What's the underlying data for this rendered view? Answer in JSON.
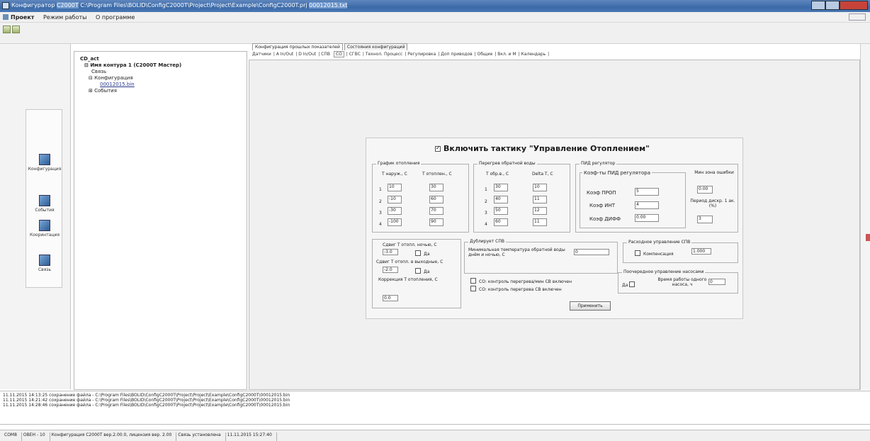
{
  "window": {
    "title_parts": [
      "Конфигуратор",
      "С2000Т",
      "C:\\Program Files\\BOLID\\ConfigC2000T\\Project\\Project\\Example\\ConfigC2000T.prj",
      "00012015.txt"
    ]
  },
  "menu": {
    "items": [
      "Проект",
      "Режим работы",
      "О программе"
    ]
  },
  "nav": {
    "items": [
      {
        "label": "Конфигурация",
        "icon": "config-icon"
      },
      {
        "label": "События",
        "icon": "events-icon"
      },
      {
        "label": "Кооринтация",
        "icon": "coordination-icon"
      },
      {
        "label": "Связь",
        "icon": "connection-icon"
      }
    ]
  },
  "tree": {
    "root": "CD_act",
    "device": "Имя контура 1 (С2000Т Мастер)",
    "nodes": [
      "Связь",
      "Конфигурация",
      "00012015.bin",
      "События"
    ]
  },
  "tabs_top": [
    "Конфигурация прошлых показателей",
    "Состояния конфигураций"
  ],
  "tabs_sub": [
    "Датчики",
    "A In/Out",
    "D In/Out",
    "СПВ",
    "CO",
    "СГВС",
    "Технол. Процесс",
    "Регулировка",
    "Доп приводов",
    "Общие",
    "Вкл. и М",
    "Календарь"
  ],
  "active_sub_tab": "CO",
  "heating": {
    "enable_label": "Включить тактику \"Управление Отоплением\"",
    "enabled": true,
    "graph": {
      "title": "График отопления",
      "col1": "Т наруж., С",
      "col2": "Т отоплен., С",
      "rows": [
        {
          "n": "1",
          "a": "10",
          "b": "30"
        },
        {
          "n": "2",
          "a": "-10",
          "b": "60"
        },
        {
          "n": "3",
          "a": "-30",
          "b": "70"
        },
        {
          "n": "4",
          "a": "-100",
          "b": "90"
        }
      ]
    },
    "return": {
      "title": "Перегрев обратной воды",
      "col1": "Т обр.в., С",
      "col2": "Delta T, С",
      "rows": [
        {
          "n": "1",
          "a": "30",
          "b": "10"
        },
        {
          "n": "2",
          "a": "40",
          "b": "11"
        },
        {
          "n": "3",
          "a": "50",
          "b": "12"
        },
        {
          "n": "4",
          "a": "60",
          "b": "11"
        }
      ]
    },
    "pid": {
      "title": "ПИД регулятор",
      "coef_title": "Коэф-ты ПИД регулятора",
      "prop_label": "Коэф ПРОП",
      "prop": "5",
      "int_label": "Коэф ИНТ",
      "int": "4",
      "diff_label": "Коэф ДИФФ",
      "diff": "0.00",
      "zone_label": "Мин зона ошибки",
      "zone": "0.00",
      "period_label": "Период дискр. 1 ак.(%)",
      "period": "3"
    },
    "shift": {
      "title": "Сдвиг Т отопл. ночью, С",
      "night": "-3.0",
      "night_chk": "Да",
      "weekend_label": "Сдвиг Т отопл. в выходные, С",
      "weekend": "-2.0",
      "weekend_chk": "Да",
      "corr_label": "Коррекция Т отопления, С",
      "corr": "0.0"
    },
    "dhw": {
      "title": "Дублирует СПВ",
      "min_label": "Минимальная температура обратной воды днём и ночью, С",
      "min": "0",
      "ctrl1": "СО: контроль перегрева/мин СВ включен",
      "ctrl2": "СО: контроль перегрева СВ включен"
    },
    "cascade": {
      "title": "Расходное управление СПВ",
      "chk": "Компенсация",
      "value": "1.000"
    },
    "pumps": {
      "title": "Поочередное управление насосами",
      "chk": "Да",
      "time_label": "Время работы одного насоса, ч",
      "time": "0"
    },
    "apply": "Применить"
  },
  "log": {
    "lines": [
      "11.11.2015 14:13:25 сохранение файла - C:\\Program Files\\BOLID\\ConfigC2000T\\Project\\Project\\Example\\ConfigC2000T\\00012015.bin",
      "11.11.2015 14:21:42 сохранение файла - C:\\Program Files\\BOLID\\ConfigC2000T\\Project\\Project\\Example\\ConfigC2000T\\00012015.bin",
      "11.11.2015 14:28:46 сохранение файла - C:\\Program Files\\BOLID\\ConfigC2000T\\Project\\Project\\Example\\ConfigC2000T\\00012015.bin"
    ]
  },
  "status": {
    "items": [
      "COM8",
      "ОВЕН - 10",
      "Конфигурация С2000Т вер.2.00.0, лицензия вер. 2.00",
      "Связь установлена",
      "11.11.2015 15:27:40"
    ]
  }
}
